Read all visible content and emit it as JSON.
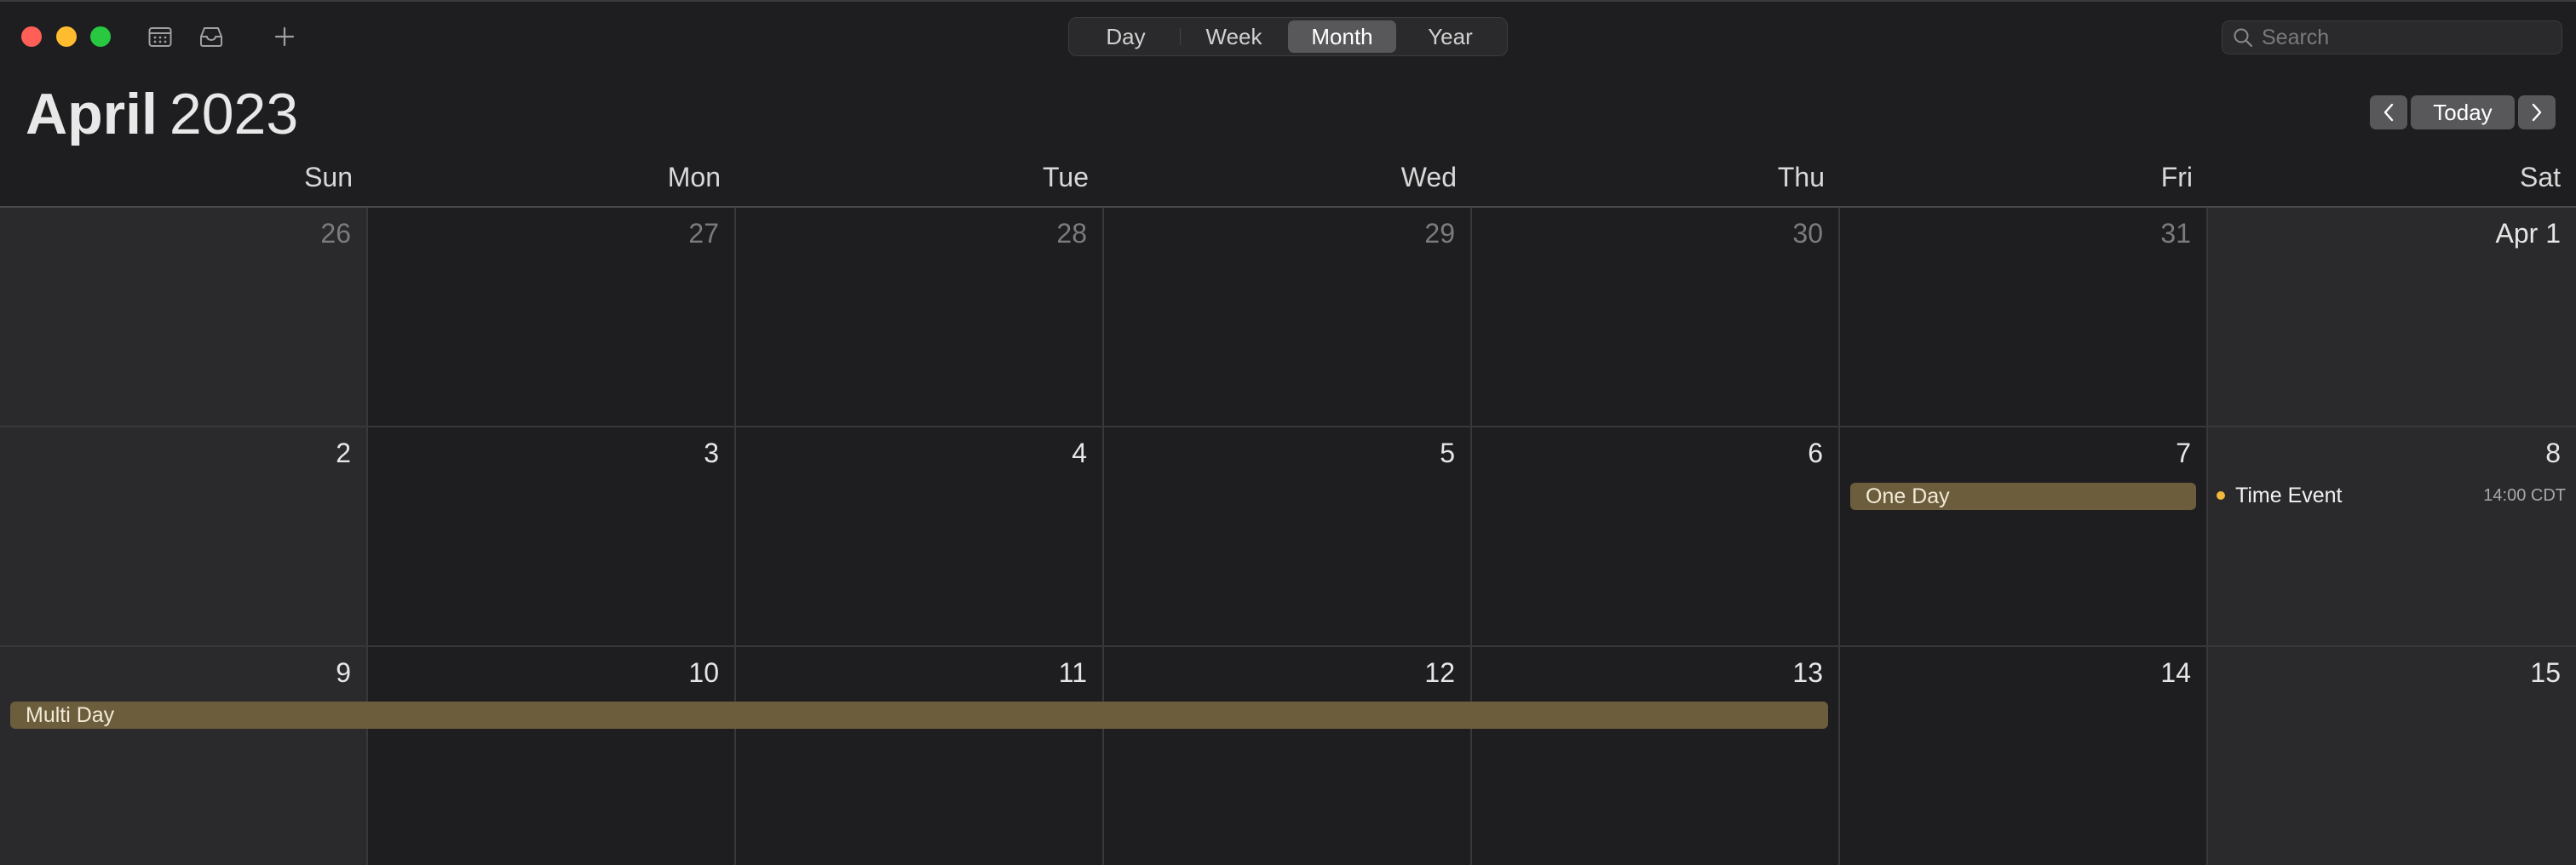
{
  "colors": {
    "background": "#1e1e20",
    "weekend_background": "#2a2a2c",
    "event_bar": "#6c5d3c",
    "event_dot": "#f0b83c",
    "selected_segment": "#58585b"
  },
  "toolbar": {
    "icons": [
      "calendar-list-icon",
      "inbox-icon",
      "plus-icon"
    ],
    "views": [
      "Day",
      "Week",
      "Month",
      "Year"
    ],
    "active_view": "Month",
    "search_placeholder": "Search"
  },
  "header": {
    "month": "April",
    "year": "2023",
    "today_label": "Today"
  },
  "weekdays": [
    "Sun",
    "Mon",
    "Tue",
    "Wed",
    "Thu",
    "Fri",
    "Sat"
  ],
  "weeks": [
    [
      "26",
      "27",
      "28",
      "29",
      "30",
      "31",
      "Apr 1"
    ],
    [
      "2",
      "3",
      "4",
      "5",
      "6",
      "7",
      "8"
    ],
    [
      "9",
      "10",
      "11",
      "12",
      "13",
      "14",
      "15"
    ]
  ],
  "events": {
    "one_day": "One Day",
    "multi_day": "Multi Day",
    "time_event": {
      "title": "Time Event",
      "time": "14:00 CDT"
    }
  }
}
